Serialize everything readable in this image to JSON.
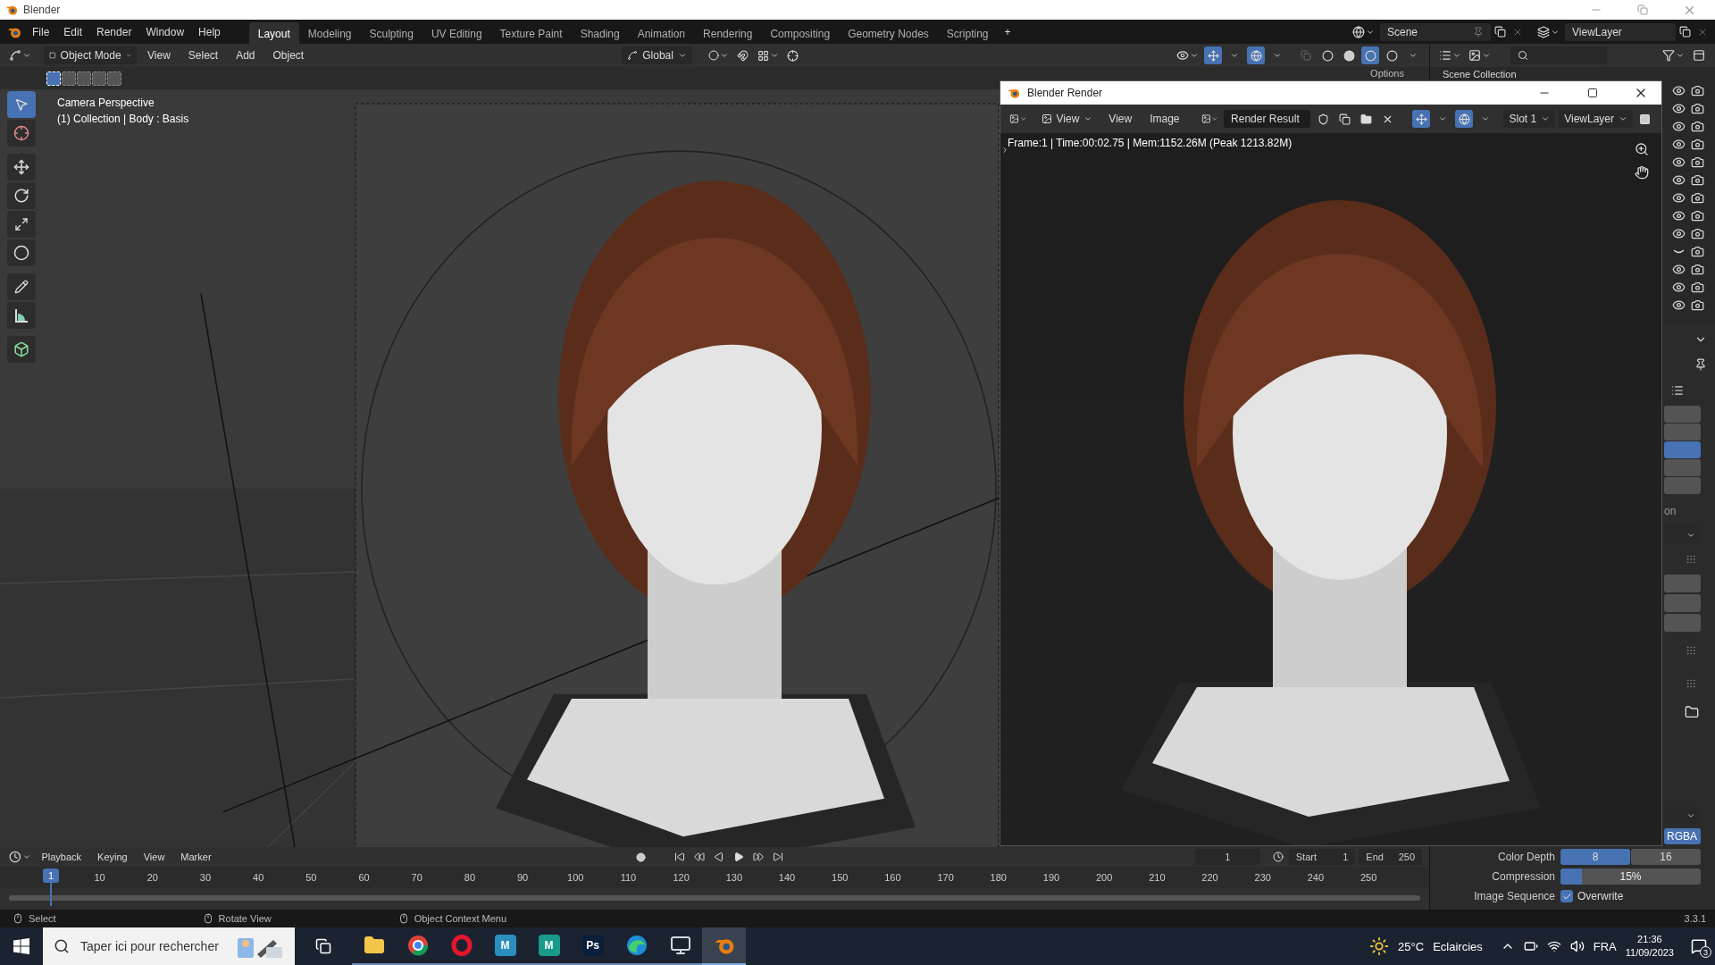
{
  "window": {
    "title": "Blender"
  },
  "menu": [
    "File",
    "Edit",
    "Render",
    "Window",
    "Help"
  ],
  "workspaces": [
    {
      "label": "Layout",
      "selected": true
    },
    {
      "label": "Modeling",
      "selected": false
    },
    {
      "label": "Sculpting",
      "selected": false
    },
    {
      "label": "UV Editing",
      "selected": false
    },
    {
      "label": "Texture Paint",
      "selected": false
    },
    {
      "label": "Shading",
      "selected": false
    },
    {
      "label": "Animation",
      "selected": false
    },
    {
      "label": "Rendering",
      "selected": false
    },
    {
      "label": "Compositing",
      "selected": false
    },
    {
      "label": "Geometry Nodes",
      "selected": false
    },
    {
      "label": "Scripting",
      "selected": false
    }
  ],
  "add_workspace": "+",
  "scene": "Scene",
  "view_layer": "ViewLayer",
  "viewport": {
    "mode": "Object Mode",
    "menus": [
      "View",
      "Select",
      "Add",
      "Object"
    ],
    "orientation": "Global",
    "options": "Options",
    "camera_label": "Camera Perspective",
    "object_info": "(1) Collection | Body : Basis",
    "select_modes": [
      {
        "selected": true
      },
      {
        "selected": false
      },
      {
        "selected": false
      },
      {
        "selected": false
      },
      {
        "selected": false
      }
    ],
    "tools": [
      {
        "kind": "select",
        "selected": true
      },
      {
        "kind": "cursor",
        "selected": false
      },
      {
        "kind": "move",
        "selected": false
      },
      {
        "kind": "rotate",
        "selected": false
      },
      {
        "kind": "scale",
        "selected": false
      },
      {
        "kind": "transform",
        "selected": false
      },
      {
        "kind": "annotate",
        "selected": false
      },
      {
        "kind": "measure",
        "selected": false
      },
      {
        "kind": "add-cube",
        "selected": false
      }
    ],
    "shading": [
      {
        "selected": false
      },
      {
        "selected": false
      },
      {
        "selected": true
      },
      {
        "selected": false
      }
    ]
  },
  "outliner": {
    "root": "Scene Collection",
    "rows": [
      {
        "visible": true
      },
      {
        "visible": true
      },
      {
        "visible": true
      },
      {
        "visible": true
      },
      {
        "visible": true
      },
      {
        "visible": true
      },
      {
        "visible": true
      },
      {
        "visible": true
      },
      {
        "visible": true
      },
      {
        "visible": false
      },
      {
        "visible": true
      },
      {
        "visible": true
      },
      {
        "visible": true
      }
    ]
  },
  "properties": {
    "list_buttons": [
      {
        "selected": false
      },
      {
        "selected": false
      },
      {
        "selected": true
      },
      {
        "selected": false
      },
      {
        "selected": false
      }
    ],
    "partial_label": "on",
    "color_mode": "RGBA",
    "color_depth_label": "Color Depth",
    "color_depth": [
      {
        "label": "8",
        "selected": true
      },
      {
        "label": "16",
        "selected": false
      }
    ],
    "compression_label": "Compression",
    "compression": {
      "reading": "15%",
      "level": 0.15
    },
    "image_sequence_label": "Image Sequence",
    "overwrite": {
      "label": "Overwrite",
      "checked": true
    }
  },
  "render_window": {
    "title": "Blender Render",
    "view_mode": "View",
    "menus": [
      "View",
      "Image"
    ],
    "image_name": "Render Result",
    "slot": "Slot 1",
    "view_layer": "ViewLayer",
    "info": "Frame:1 | Time:00:02.75 | Mem:1152.26M (Peak 1213.82M)"
  },
  "timeline": {
    "menus": [
      "Playback",
      "Keying",
      "View",
      "Marker"
    ],
    "current_frame": "1",
    "start_label": "Start",
    "start": "1",
    "end_label": "End",
    "end": "250",
    "playhead": "1",
    "ticks": [
      "10",
      "20",
      "30",
      "40",
      "50",
      "60",
      "70",
      "80",
      "90",
      "100",
      "110",
      "120",
      "130",
      "140",
      "150",
      "160",
      "170",
      "180",
      "190",
      "200",
      "210",
      "220",
      "230",
      "240",
      "250"
    ]
  },
  "status_bar": {
    "hints": [
      "Select",
      "Rotate View",
      "Object Context Menu"
    ],
    "version": "3.3.1"
  },
  "taskbar": {
    "search_placeholder": "Taper ici pour rechercher",
    "apps": [
      {
        "kind": "folder",
        "selected": false
      },
      {
        "kind": "browser",
        "selected": false
      },
      {
        "kind": "ring",
        "selected": false
      },
      {
        "kind": "tile",
        "glyph": "M",
        "color": "#2a8fbd",
        "selected": false
      },
      {
        "kind": "tile",
        "glyph": "M",
        "color": "#1a9a8a",
        "selected": false
      },
      {
        "kind": "tile",
        "glyph": "Ps",
        "color": "#0a1f3a",
        "selected": false
      },
      {
        "kind": "wave",
        "selected": false
      },
      {
        "kind": "device",
        "selected": false
      },
      {
        "kind": "blender",
        "selected": true
      }
    ],
    "temperature": "25°C",
    "weather": "Eclaircies",
    "language": "FRA",
    "time": "21:36",
    "date": "11/09/2023",
    "notifications": "3"
  }
}
